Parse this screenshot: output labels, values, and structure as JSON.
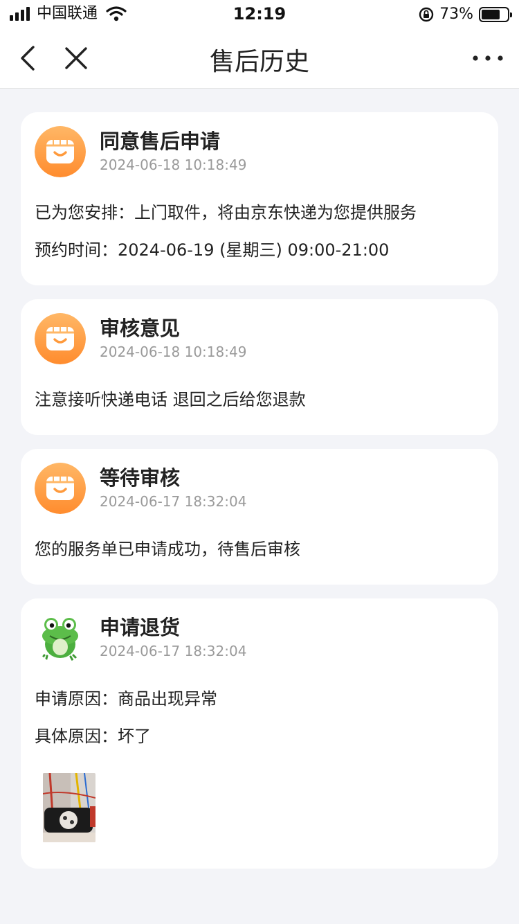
{
  "status_bar": {
    "carrier": "中国联通",
    "time": "12:19",
    "battery_percent": "73%",
    "battery_level": 0.73,
    "icons": [
      "signal-icon",
      "wifi-icon",
      "rotation-lock-icon",
      "battery-icon"
    ]
  },
  "nav": {
    "title": "售后历史",
    "icons": [
      "back-icon",
      "close-icon",
      "more-icon"
    ]
  },
  "cards": [
    {
      "avatar": "store-avatar",
      "title": "同意售后申请",
      "time": "2024-06-18 10:18:49",
      "lines": [
        "已为您安排：上门取件，将由京东快递为您提供服务",
        "预约时间：2024-06-19 (星期三) 09:00-21:00"
      ]
    },
    {
      "avatar": "store-avatar",
      "title": "审核意见",
      "time": "2024-06-18 10:18:49",
      "lines": [
        "注意接听快递电话 退回之后给您退款"
      ]
    },
    {
      "avatar": "store-avatar",
      "title": "等待审核",
      "time": "2024-06-17 18:32:04",
      "lines": [
        "您的服务单已申请成功，待售后审核"
      ]
    },
    {
      "avatar": "frog-avatar",
      "title": "申请退货",
      "time": "2024-06-17 18:32:04",
      "lines": [
        "申请原因：商品出现异常",
        "具体原因：坏了"
      ],
      "photo": "product-photo-thumbnail"
    }
  ],
  "colors": {
    "page_bg": "#f3f4f8",
    "store_avatar_orange": "#ff9a3c",
    "timestamp_gray": "#9a9a9a"
  }
}
